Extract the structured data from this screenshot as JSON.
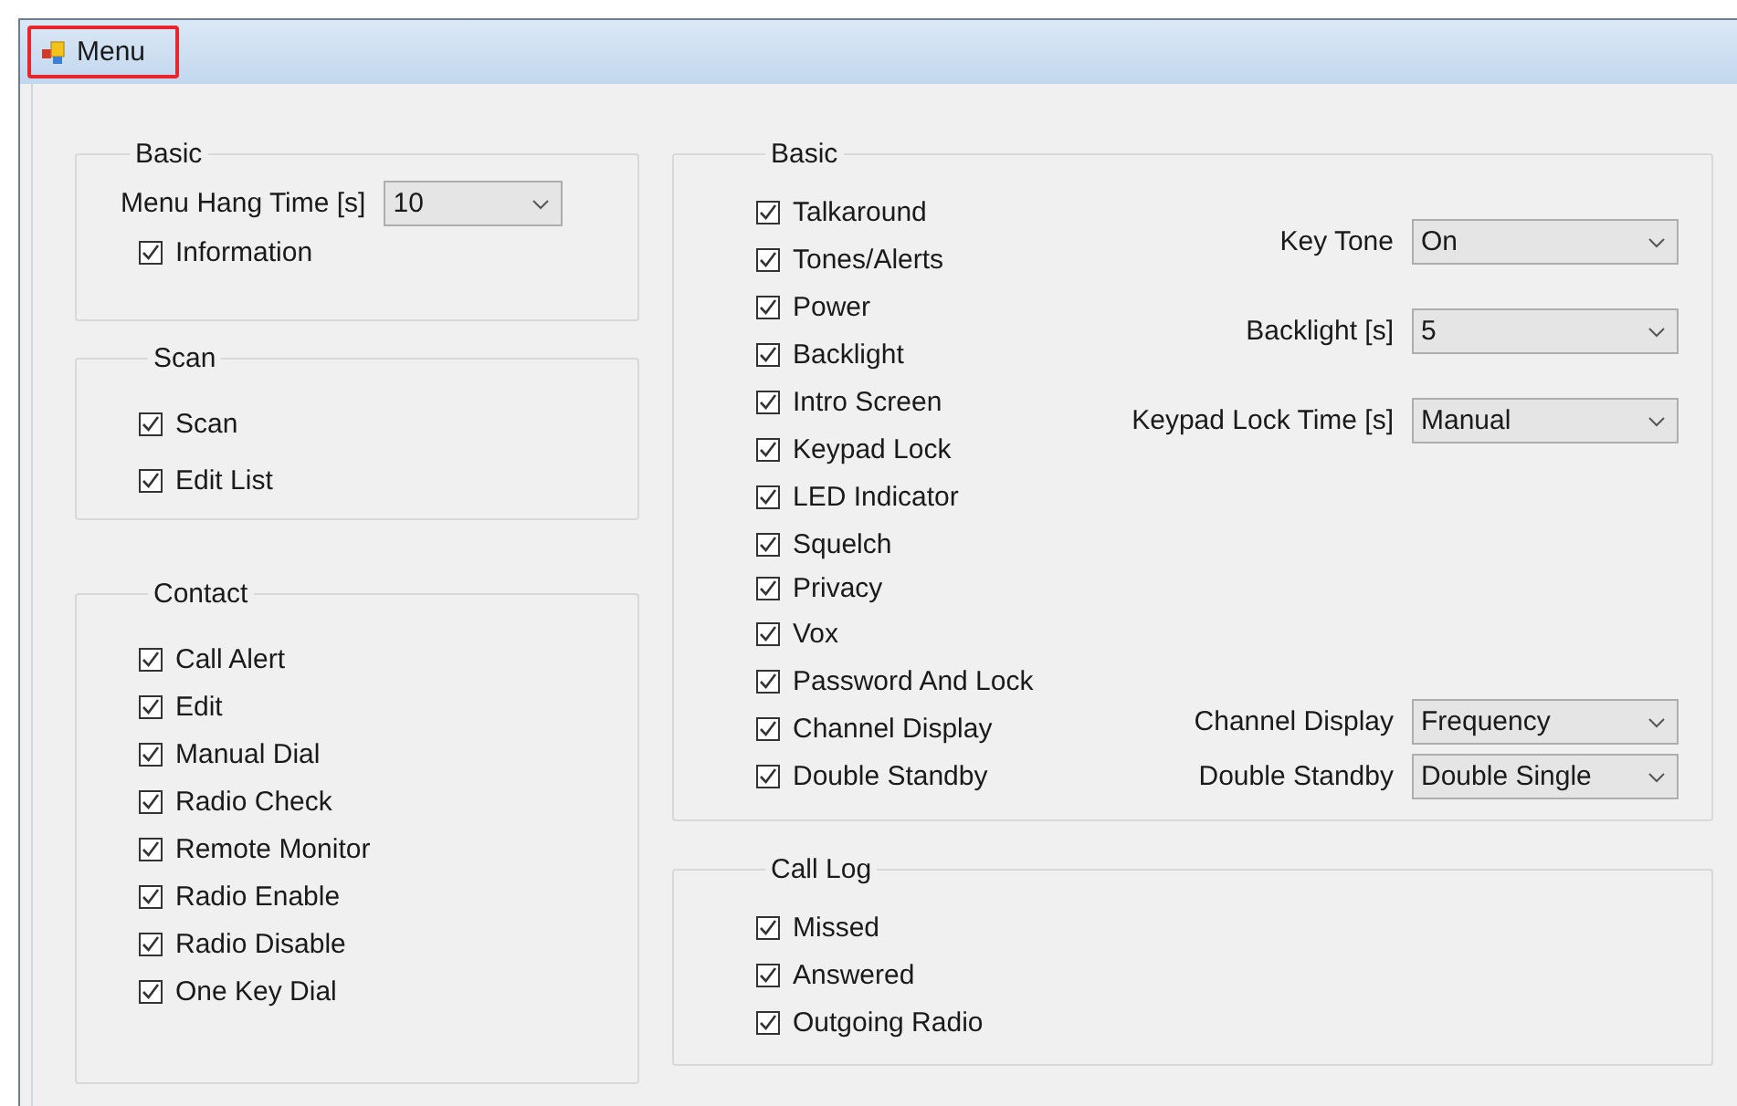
{
  "window": {
    "title": "Menu"
  },
  "left_groups": [
    {
      "title": "Basic",
      "fields": [
        {
          "label": "Menu Hang Time [s]",
          "value": "10"
        }
      ],
      "checks": [
        {
          "label": "Information",
          "checked": true
        }
      ]
    },
    {
      "title": "Scan",
      "checks": [
        {
          "label": "Scan",
          "checked": true
        },
        {
          "label": "Edit List",
          "checked": true
        }
      ]
    },
    {
      "title": "Contact",
      "checks": [
        {
          "label": "Call Alert",
          "checked": true
        },
        {
          "label": "Edit",
          "checked": true
        },
        {
          "label": "Manual Dial",
          "checked": true
        },
        {
          "label": "Radio Check",
          "checked": true
        },
        {
          "label": "Remote Monitor",
          "checked": true
        },
        {
          "label": "Radio Enable",
          "checked": true
        },
        {
          "label": "Radio Disable",
          "checked": true
        },
        {
          "label": "One Key Dial",
          "checked": true
        }
      ]
    }
  ],
  "right_basic": {
    "title": "Basic",
    "checks": [
      {
        "label": "Talkaround",
        "checked": true
      },
      {
        "label": "Tones/Alerts",
        "checked": true
      },
      {
        "label": "Power",
        "checked": true
      },
      {
        "label": "Backlight",
        "checked": true
      },
      {
        "label": "Intro Screen",
        "checked": true
      },
      {
        "label": "Keypad Lock",
        "checked": true
      },
      {
        "label": "LED Indicator",
        "checked": true
      },
      {
        "label": "Squelch",
        "checked": true
      },
      {
        "label": "Privacy",
        "checked": true
      },
      {
        "label": "Vox",
        "checked": true
      },
      {
        "label": "Password And Lock",
        "checked": true
      },
      {
        "label": "Channel Display",
        "checked": true
      },
      {
        "label": "Double Standby",
        "checked": true
      }
    ],
    "settings": [
      {
        "label": "Key Tone",
        "value": "On"
      },
      {
        "label": "Backlight [s]",
        "value": "5"
      },
      {
        "label": "Keypad Lock Time [s]",
        "value": "Manual"
      },
      {
        "label": "Channel Display",
        "value": "Frequency"
      },
      {
        "label": "Double Standby",
        "value": "Double Single"
      }
    ]
  },
  "call_log": {
    "title": "Call Log",
    "checks": [
      {
        "label": "Missed",
        "checked": true
      },
      {
        "label": "Answered",
        "checked": true
      },
      {
        "label": "Outgoing Radio",
        "checked": true
      }
    ]
  }
}
